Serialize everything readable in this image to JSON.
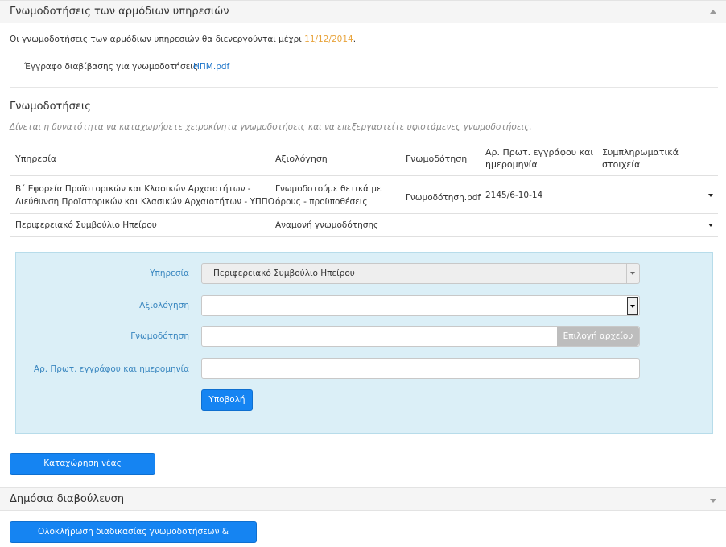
{
  "panel1": {
    "title": "Γνωμοδοτήσεις των αρμόδιων υπηρεσιών",
    "deadline_text": "Οι γνωμοδοτήσεις των αρμόδιων υπηρεσιών θα διενεργούνται μέχρι ",
    "deadline_date": "11/12/2014",
    "deadline_suffix": ".",
    "doc_label": "Έγγραφο διαβίβασης για γνωμοδοτήσεις",
    "doc_link": "ΗΠΜ.pdf"
  },
  "opinions": {
    "title": "Γνωμοδοτήσεις",
    "subtitle": "Δίνεται η δυνατότητα να καταχωρήσετε χειροκίνητα γνωμοδοτήσεις και να επεξεργαστείτε υφιστάμενες γνωμοδοτήσεις.",
    "columns": {
      "service": "Υπηρεσία",
      "evaluation": "Αξιολόγηση",
      "opinion": "Γνωμοδότηση",
      "protocol_line1": "Αρ. Πρωτ. εγγράφου και",
      "protocol_line2": "ημερομηνία",
      "extra_line1": "Συμπληρωματικά",
      "extra_line2": "στοιχεία"
    },
    "rows": [
      {
        "service_line1": "Β΄ Εφορεία Προϊστορικών και Κλασικών Αρχαιοτήτων -",
        "service_line2": "Διεύθυνση Προϊστορικών και Κλασικών Αρχαιοτήτων - ΥΠΠΟ",
        "evaluation_line1": "Γνωμοδοτούμε θετικά με",
        "evaluation_line2": "όρους - προϋποθέσεις",
        "opinion_file": "Γνωμοδότηση.pdf",
        "protocol": "2145/6-10-14"
      },
      {
        "service_line1": "Περιφερειακό Συμβούλιο Ηπείρου",
        "evaluation_line1": "Αναμονή γνωμοδότησης"
      }
    ]
  },
  "form": {
    "service_label": "Υπηρεσία",
    "service_value": "Περιφερειακό Συμβούλιο Ηπείρου",
    "evaluation_label": "Αξιολόγηση",
    "evaluation_value": "",
    "opinion_label": "Γνωμοδότηση",
    "file_button": "Επιλογή αρχείου",
    "protocol_label": "Αρ. Πρωτ. εγγράφου και ημερομηνία",
    "protocol_value": "",
    "submit_label": "Υποβολή"
  },
  "new_opinion_button": "Καταχώρηση νέας γνωμοδότησης",
  "panel2": {
    "title": "Δημόσια διαβούλευση"
  },
  "complete_button": "Ολοκλήρωση διαδικασίας γνωμοδοτήσεων & διαβούλευσης"
}
